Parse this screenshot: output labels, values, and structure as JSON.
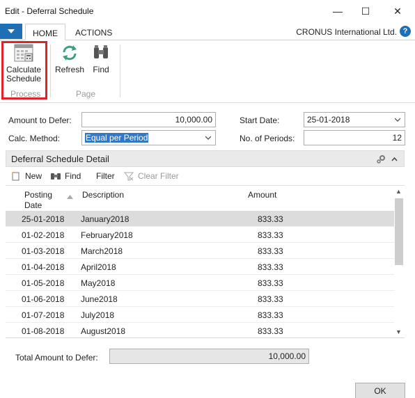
{
  "window": {
    "title": "Edit - Deferral Schedule",
    "minimize": "—",
    "maximize": "☐",
    "close": "✕"
  },
  "ribbon": {
    "tabs": [
      "HOME",
      "ACTIONS"
    ],
    "company": "CRONUS International Ltd.",
    "help": "?",
    "buttons": {
      "calculate": "Calculate Schedule",
      "refresh": "Refresh",
      "find": "Find"
    },
    "groups": {
      "process": "Process",
      "page": "Page"
    }
  },
  "form": {
    "amount_label": "Amount to Defer:",
    "amount_value": "10,000.00",
    "method_label": "Calc. Method:",
    "method_value": "Equal per Period",
    "start_label": "Start Date:",
    "start_value": "25-01-2018",
    "periods_label": "No. of Periods:",
    "periods_value": "12"
  },
  "detail": {
    "title": "Deferral Schedule Detail",
    "toolbar": {
      "new": "New",
      "find": "Find",
      "filter": "Filter",
      "clear_filter": "Clear Filter"
    },
    "columns": {
      "posting_date": "Posting Date",
      "description": "Description",
      "amount": "Amount"
    },
    "rows": [
      {
        "date": "25-01-2018",
        "desc": "January2018",
        "amount": "833.33"
      },
      {
        "date": "01-02-2018",
        "desc": "February2018",
        "amount": "833.33"
      },
      {
        "date": "01-03-2018",
        "desc": "March2018",
        "amount": "833.33"
      },
      {
        "date": "01-04-2018",
        "desc": "April2018",
        "amount": "833.33"
      },
      {
        "date": "01-05-2018",
        "desc": "May2018",
        "amount": "833.33"
      },
      {
        "date": "01-06-2018",
        "desc": "June2018",
        "amount": "833.33"
      },
      {
        "date": "01-07-2018",
        "desc": "July2018",
        "amount": "833.33"
      },
      {
        "date": "01-08-2018",
        "desc": "August2018",
        "amount": "833.33"
      }
    ]
  },
  "footer": {
    "total_label": "Total Amount to Defer:",
    "total_value": "10,000.00",
    "ok": "OK"
  },
  "colors": {
    "accent": "#1f6fb6",
    "highlight": "#e0202a",
    "selection": "#3178c6"
  }
}
